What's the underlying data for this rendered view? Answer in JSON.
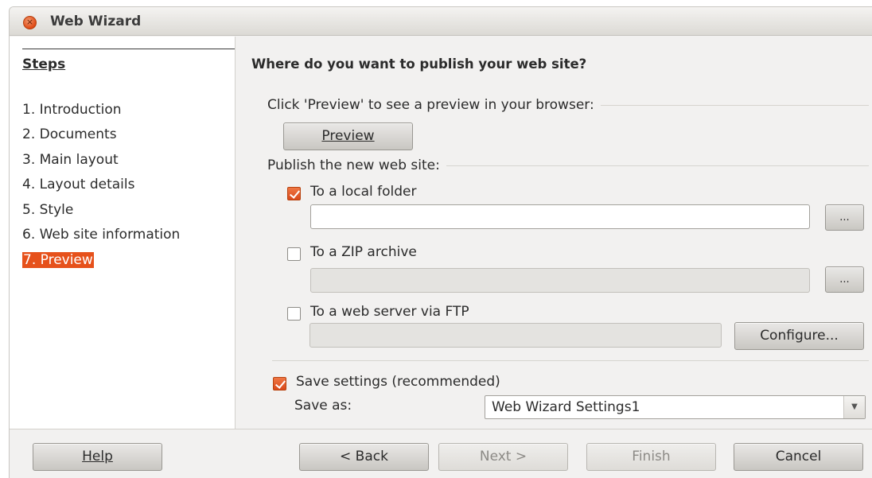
{
  "window": {
    "title": "Web Wizard",
    "close_icon": "close-icon"
  },
  "steps": {
    "heading": "Steps",
    "items": [
      {
        "label": "1. Introduction"
      },
      {
        "label": "2. Documents"
      },
      {
        "label": "3. Main layout"
      },
      {
        "label": "4. Layout details"
      },
      {
        "label": "5. Style"
      },
      {
        "label": "6. Web site information"
      },
      {
        "label": "7. Preview",
        "active": true
      }
    ]
  },
  "main": {
    "heading": "Where do you want to publish your web site?",
    "preview_section": "Click 'Preview' to see a preview in your browser:",
    "preview_button": "Preview",
    "publish_section": "Publish the new web site:",
    "local_folder": {
      "label": "To a local folder",
      "checked": true,
      "value": "",
      "browse": "..."
    },
    "zip_archive": {
      "label": "To a ZIP archive",
      "checked": false,
      "value": "",
      "browse": "..."
    },
    "ftp": {
      "label": "To a web server via FTP",
      "checked": false,
      "value": "",
      "configure": "Configure..."
    },
    "save_settings": {
      "label": "Save settings (recommended)",
      "checked": true
    },
    "save_as_label": "Save as:",
    "save_as_value": "Web Wizard Settings1"
  },
  "footer": {
    "help": "Help",
    "back": "< Back",
    "next": "Next >",
    "finish": "Finish",
    "cancel": "Cancel"
  },
  "colors": {
    "accent": "#e6511b",
    "window_bg": "#f2f1f0"
  }
}
